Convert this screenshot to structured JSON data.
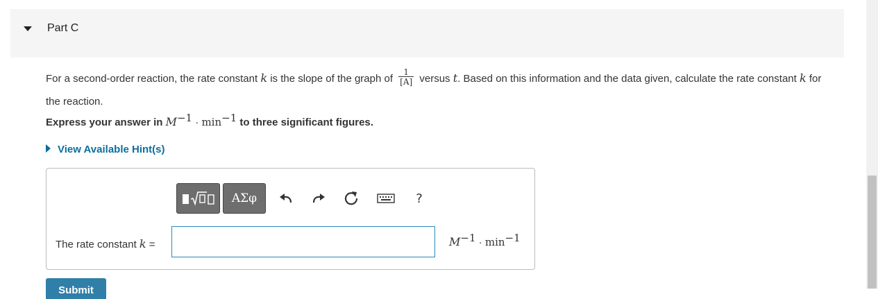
{
  "part": {
    "title": "Part C"
  },
  "question": {
    "text_1": "For a second-order reaction, the rate constant ",
    "var_k": "k",
    "text_2": " is the slope of the graph of ",
    "fraction": {
      "numerator": "1",
      "denominator": "[A]"
    },
    "text_3": " versus ",
    "var_t": "t",
    "text_4": ". Based on this information and the data given, calculate the rate constant ",
    "var_k2": "k",
    "text_5": " for the reaction."
  },
  "instruction": {
    "prefix": "Express your answer in ",
    "unit_M": "M",
    "exp_1": "−1",
    "dot": " · ",
    "unit_min": "min",
    "exp_2": "−1",
    "suffix": " to three significant figures."
  },
  "hint": {
    "label": "View Available Hint(s)"
  },
  "toolbar": {
    "templates_icon": "templates-icon",
    "symbols_label": "ΑΣφ",
    "undo_icon": "undo-icon",
    "redo_icon": "redo-icon",
    "reset_icon": "reset-icon",
    "keyboard_icon": "keyboard-icon",
    "help_label": "?"
  },
  "answer": {
    "label_prefix": "The rate constant ",
    "label_var": "k",
    "label_suffix": " =",
    "value": "",
    "units": {
      "M": "M",
      "exp_1": "−1",
      "dot": " · ",
      "min": "min",
      "exp_2": "−1"
    }
  },
  "submit": {
    "label": "Submit"
  },
  "colors": {
    "link": "#0c6e9c",
    "button": "#2f7fa8",
    "input_border": "#2a89b8",
    "header_bg": "#f5f5f5"
  }
}
